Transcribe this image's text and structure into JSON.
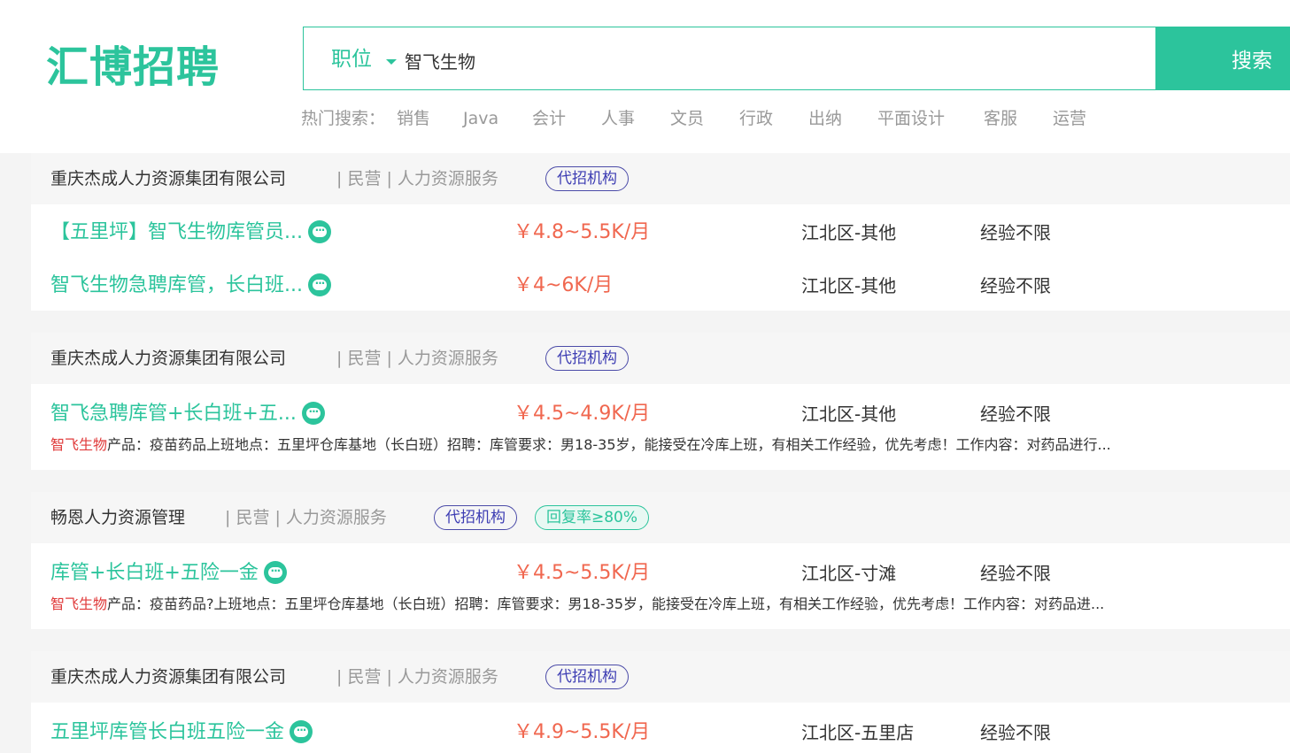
{
  "header": {
    "logo": "汇博招聘",
    "search_type": "职位",
    "search_value": "智飞生物",
    "search_button": "搜索",
    "hot_label": "热门搜索：",
    "hot_items": [
      "销售",
      "Java",
      "会计",
      "人事",
      "文员",
      "行政",
      "出纳",
      "平面设计",
      "客服",
      "运营"
    ]
  },
  "colors": {
    "brand": "#2cc49c",
    "salary": "#f0674f",
    "tag_border": "#4b4ba8",
    "highlight": "#e03a3a"
  },
  "listings": [
    {
      "company": "重庆杰成人力资源集团有限公司",
      "meta": "| 民营 | 人力资源服务",
      "tags": [
        "代招机构"
      ],
      "jobs": [
        {
          "title": "【五里坪】智飞生物库管员...",
          "salary": "￥4.8~5.5K/月",
          "location": "江北区-其他",
          "experience": "经验不限"
        },
        {
          "title": "智飞生物急聘库管，长白班...",
          "salary": "￥4~6K/月",
          "location": "江北区-其他",
          "experience": "经验不限"
        }
      ]
    },
    {
      "company": "重庆杰成人力资源集团有限公司",
      "meta": "| 民营 | 人力资源服务",
      "tags": [
        "代招机构"
      ],
      "jobs": [
        {
          "title": "智飞急聘库管+长白班+五...",
          "salary": "￥4.5~4.9K/月",
          "location": "江北区-其他",
          "experience": "经验不限",
          "desc_hl": "智飞生物",
          "desc": "产品：疫苗药品上班地点：五里坪仓库基地（长白班）招聘：库管要求：男18-35岁，能接受在冷库上班，有相关工作经验，优先考虑！工作内容：对药品进行..."
        }
      ]
    },
    {
      "company": "畅恩人力资源管理",
      "meta": "| 民营 | 人力资源服务",
      "tags": [
        "代招机构",
        "回复率≥80%"
      ],
      "jobs": [
        {
          "title": "库管+长白班+五险一金",
          "salary": "￥4.5~5.5K/月",
          "location": "江北区-寸滩",
          "experience": "经验不限",
          "desc_hl": "智飞生物",
          "desc": "产品：疫苗药品?上班地点：五里坪仓库基地（长白班）招聘：库管要求：男18-35岁，能接受在冷库上班，有相关工作经验，优先考虑！工作内容：对药品进..."
        }
      ]
    },
    {
      "company": "重庆杰成人力资源集团有限公司",
      "meta": "| 民营 | 人力资源服务",
      "tags": [
        "代招机构"
      ],
      "jobs": [
        {
          "title": "五里坪库管长白班五险一金",
          "salary": "￥4.9~5.5K/月",
          "location": "江北区-五里店",
          "experience": "经验不限"
        }
      ]
    }
  ]
}
